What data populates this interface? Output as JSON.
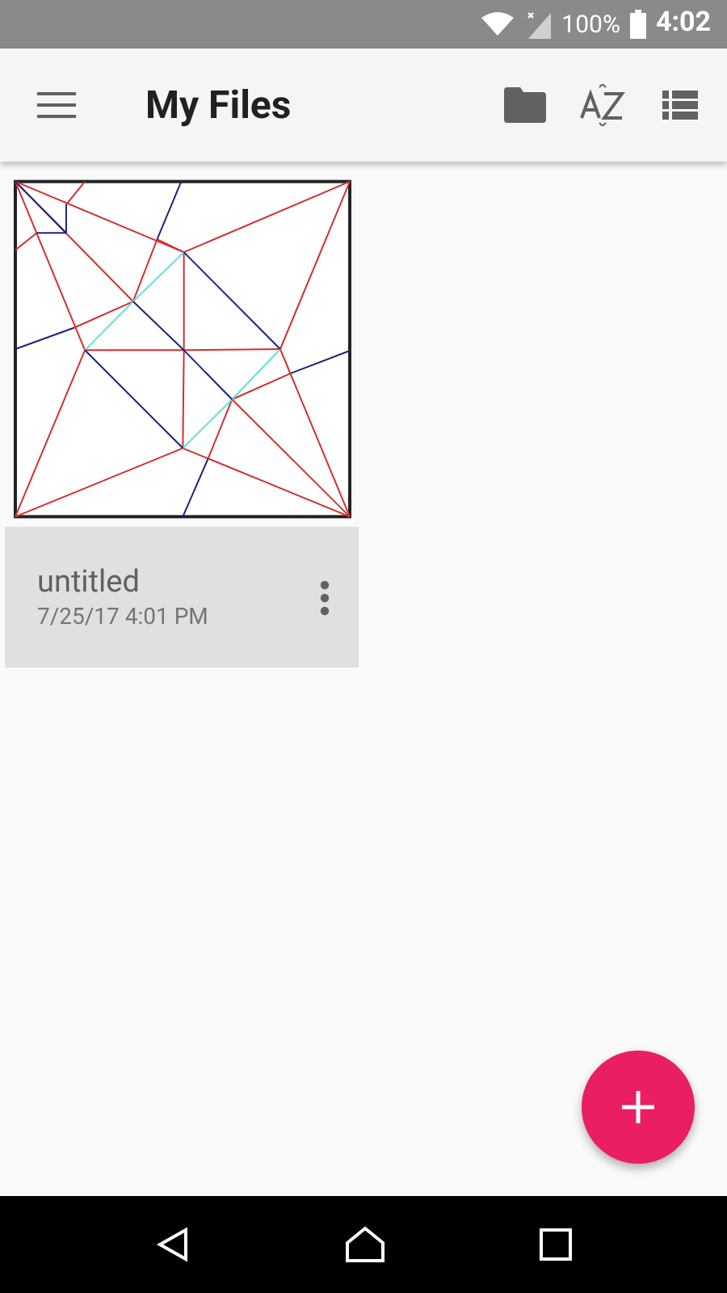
{
  "status_bar": {
    "battery": "100%",
    "time": "4:02"
  },
  "toolbar": {
    "title": "My Files"
  },
  "files": [
    {
      "name": "untitled",
      "date": "7/25/17 4:01 PM"
    }
  ]
}
